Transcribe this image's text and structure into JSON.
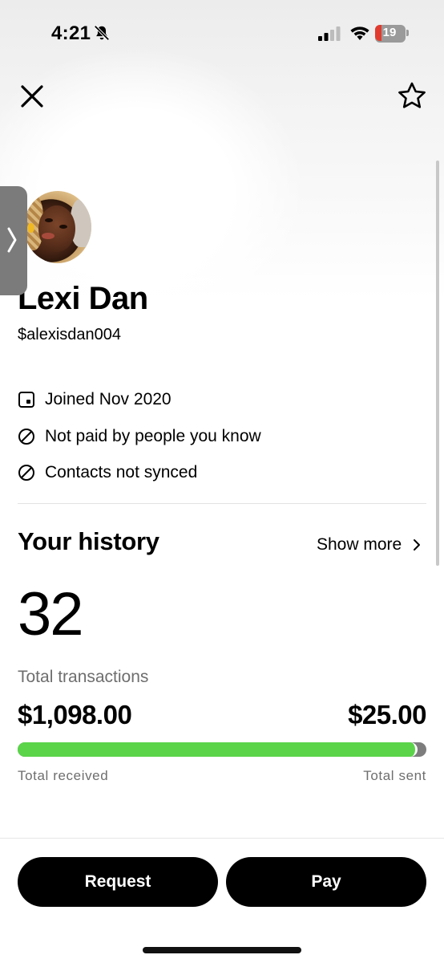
{
  "status_bar": {
    "time": "4:21",
    "battery_level": "19",
    "icons": [
      "bell-slash-icon",
      "cellular-signal-icon",
      "wifi-icon",
      "battery-icon"
    ]
  },
  "header": {
    "close_icon": "close-icon",
    "favorite_icon": "star-outline-icon"
  },
  "profile": {
    "name": "Lexi Dan",
    "cashtag": "$alexisdan004",
    "info": [
      {
        "icon": "calendar-square-icon",
        "text": "Joined Nov 2020"
      },
      {
        "icon": "prohibited-circle-icon",
        "text": "Not paid by people you know"
      },
      {
        "icon": "prohibited-circle-icon",
        "text": "Contacts not synced"
      }
    ]
  },
  "history": {
    "title": "Your history",
    "show_more": "Show more",
    "total_transactions": "32",
    "total_transactions_label": "Total transactions",
    "total_received": "$1,098.00",
    "total_sent": "$25.00",
    "total_received_label": "Total received",
    "total_sent_label": "Total sent",
    "received_fraction": 0.978,
    "colors": {
      "received": "#5bd44a",
      "sent": "#7d7d7d"
    }
  },
  "actions": {
    "request_label": "Request",
    "pay_label": "Pay"
  }
}
